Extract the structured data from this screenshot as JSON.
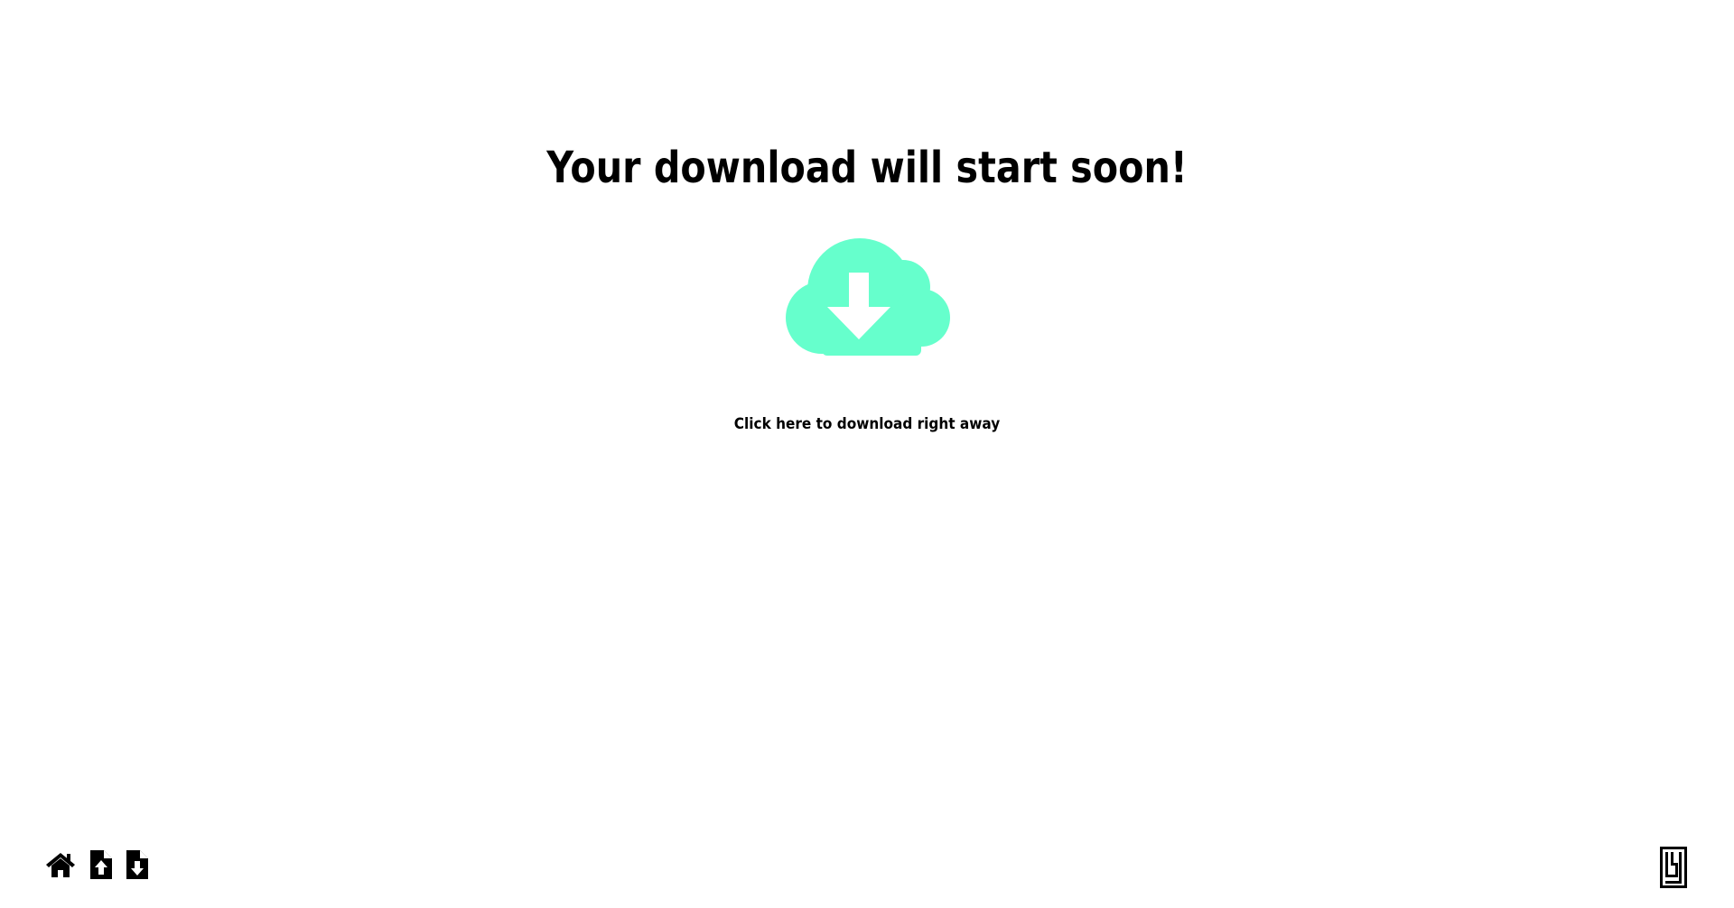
{
  "page": {
    "heading": "Your download will start soon!",
    "download_link_label": "Click here to download right away",
    "accent_color": "#66ffcc"
  },
  "hero_icon": "cloud-download-icon",
  "footer": {
    "nav_icons": [
      "home-icon",
      "file-upload-icon",
      "file-download-icon"
    ],
    "logo_icon": "brand-logo-icon"
  }
}
